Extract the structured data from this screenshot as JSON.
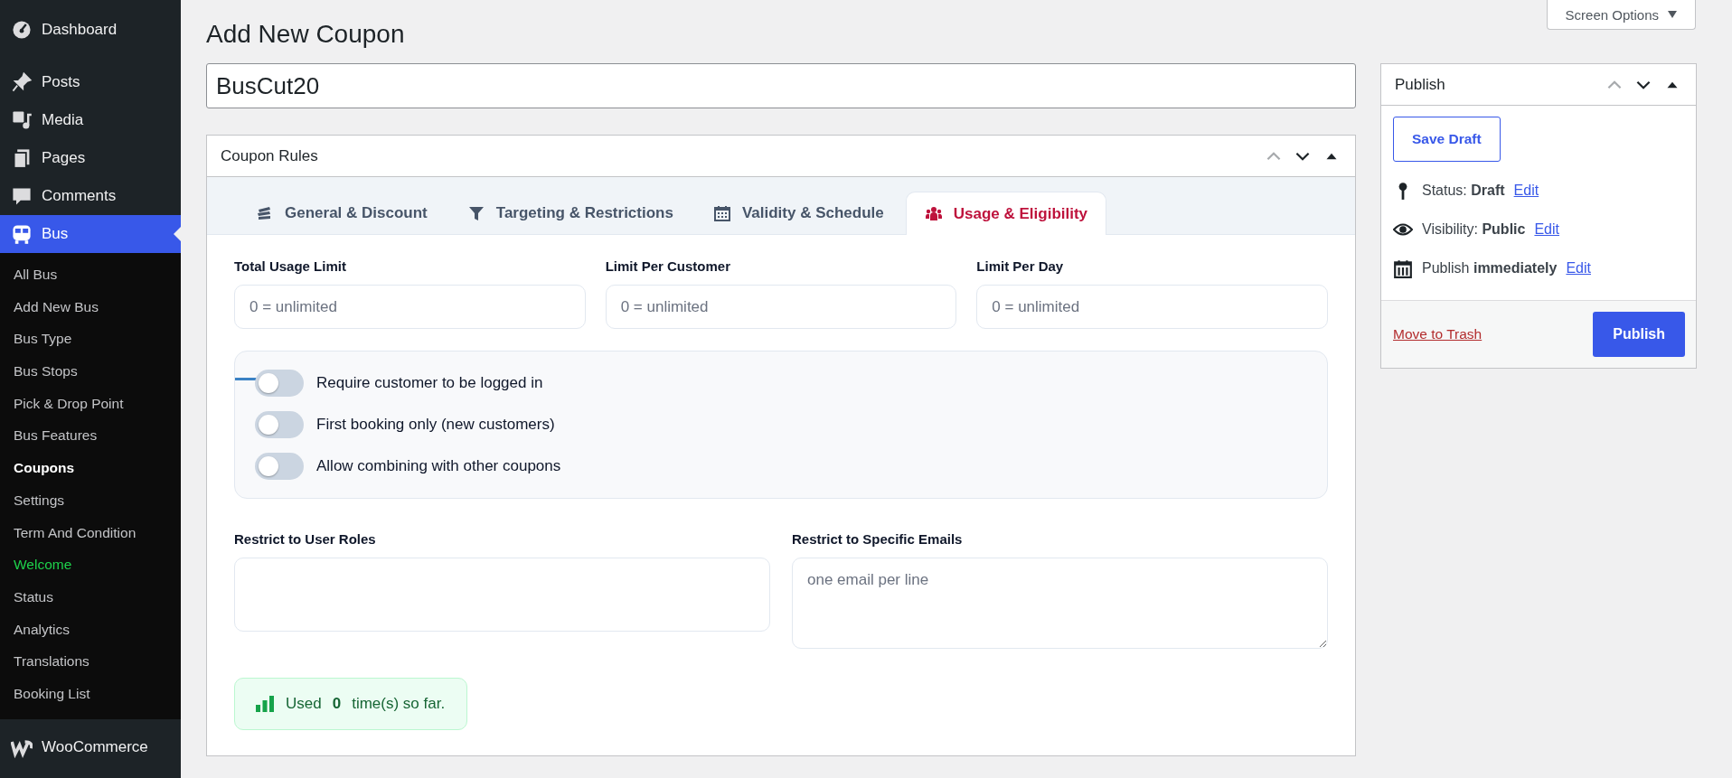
{
  "sidebar": {
    "menu": [
      {
        "label": "Dashboard",
        "selected": false
      },
      {
        "label": "Posts",
        "selected": false
      },
      {
        "label": "Media",
        "selected": false
      },
      {
        "label": "Pages",
        "selected": false
      },
      {
        "label": "Comments",
        "selected": false
      },
      {
        "label": "Bus",
        "selected": true
      }
    ],
    "submenu": [
      {
        "label": "All Bus",
        "selected": false,
        "kind": "normal"
      },
      {
        "label": "Add New Bus",
        "selected": false,
        "kind": "normal"
      },
      {
        "label": "Bus Type",
        "selected": false,
        "kind": "normal"
      },
      {
        "label": "Bus Stops",
        "selected": false,
        "kind": "normal"
      },
      {
        "label": "Pick & Drop Point",
        "selected": false,
        "kind": "normal"
      },
      {
        "label": "Bus Features",
        "selected": false,
        "kind": "normal"
      },
      {
        "label": "Coupons",
        "selected": true,
        "kind": "normal"
      },
      {
        "label": "Settings",
        "selected": false,
        "kind": "normal"
      },
      {
        "label": "Term And Condition",
        "selected": false,
        "kind": "normal"
      },
      {
        "label": "Welcome",
        "selected": false,
        "kind": "promo"
      },
      {
        "label": "Status",
        "selected": false,
        "kind": "normal"
      },
      {
        "label": "Analytics",
        "selected": false,
        "kind": "normal"
      },
      {
        "label": "Translations",
        "selected": false,
        "kind": "normal"
      },
      {
        "label": "Booking List",
        "selected": false,
        "kind": "normal"
      }
    ],
    "after": [
      {
        "label": "WooCommerce",
        "selected": false
      }
    ]
  },
  "screen_options": "Screen Options",
  "page_title": "Add New Coupon",
  "coupon_title": "BusCut20",
  "coupon_rules": {
    "title": "Coupon Rules",
    "tabs": [
      {
        "label": "General & Discount",
        "selected": false
      },
      {
        "label": "Targeting & Restrictions",
        "selected": false
      },
      {
        "label": "Validity & Schedule",
        "selected": false
      },
      {
        "label": "Usage & Eligibility",
        "selected": true
      }
    ],
    "limits": [
      {
        "label": "Total Usage Limit",
        "placeholder": "0 = unlimited"
      },
      {
        "label": "Limit Per Customer",
        "placeholder": "0 = unlimited"
      },
      {
        "label": "Limit Per Day",
        "placeholder": "0 = unlimited"
      }
    ],
    "toggles": [
      {
        "label": "Require customer to be logged in",
        "on": false,
        "focused": true
      },
      {
        "label": "First booking only (new customers)",
        "on": false,
        "focused": false
      },
      {
        "label": "Allow combining with other coupons",
        "on": false,
        "focused": false
      }
    ],
    "user_roles": {
      "label": "Restrict to User Roles"
    },
    "emails": {
      "label": "Restrict to Specific Emails",
      "placeholder": "one email per line"
    },
    "usage": {
      "prefix": "Used",
      "count": "0",
      "suffix": "time(s) so far."
    }
  },
  "publish": {
    "title": "Publish",
    "save_draft": "Save Draft",
    "rows": [
      {
        "kind": "status",
        "label": "Status:",
        "value": "Draft",
        "link": "Edit"
      },
      {
        "kind": "visibility",
        "label": "Visibility:",
        "value": "Public",
        "link": "Edit"
      },
      {
        "kind": "schedule",
        "label": "Publish",
        "value": "immediately",
        "link": "Edit"
      }
    ],
    "trash": "Move to Trash",
    "publish_button": "Publish"
  }
}
